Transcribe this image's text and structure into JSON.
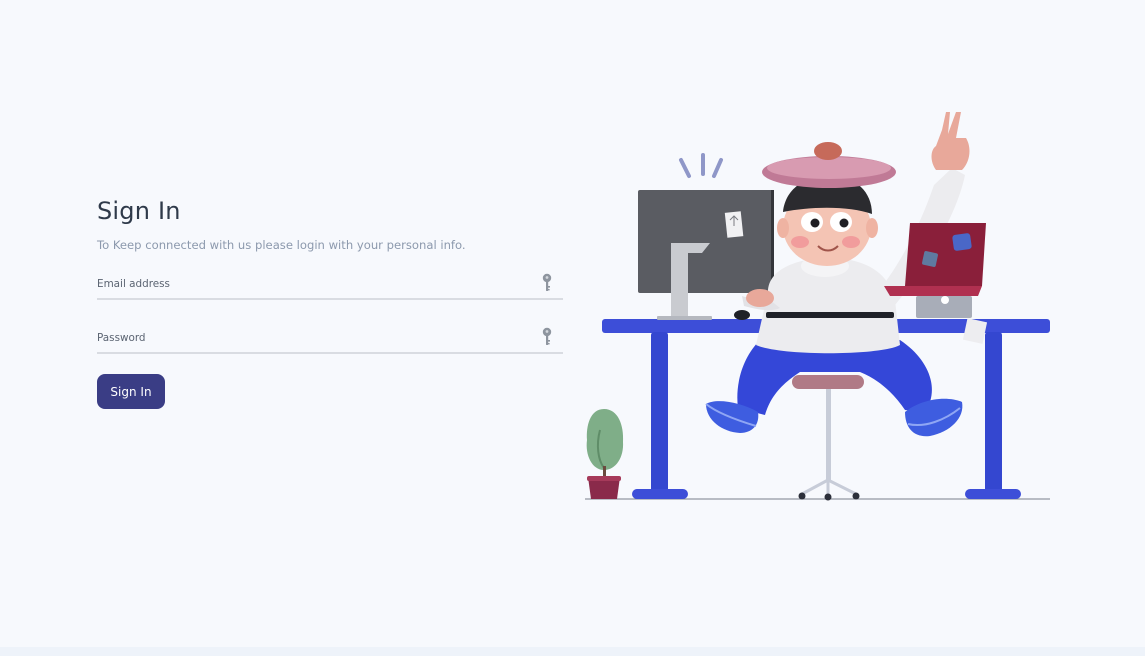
{
  "signin": {
    "title": "Sign In",
    "subtitle": "To Keep connected with us please login with your personal info.",
    "email": {
      "placeholder": "Email address",
      "value": ""
    },
    "password": {
      "placeholder": "Password",
      "value": ""
    },
    "button_label": "Sign In"
  },
  "colors": {
    "background": "#f7f9fd",
    "button": "#3a3d85",
    "title": "#2f3a4a",
    "subtitle": "#8c99ad",
    "desk": "#3d4ed8"
  },
  "icons": {
    "email": "key-icon",
    "password": "key-icon"
  }
}
